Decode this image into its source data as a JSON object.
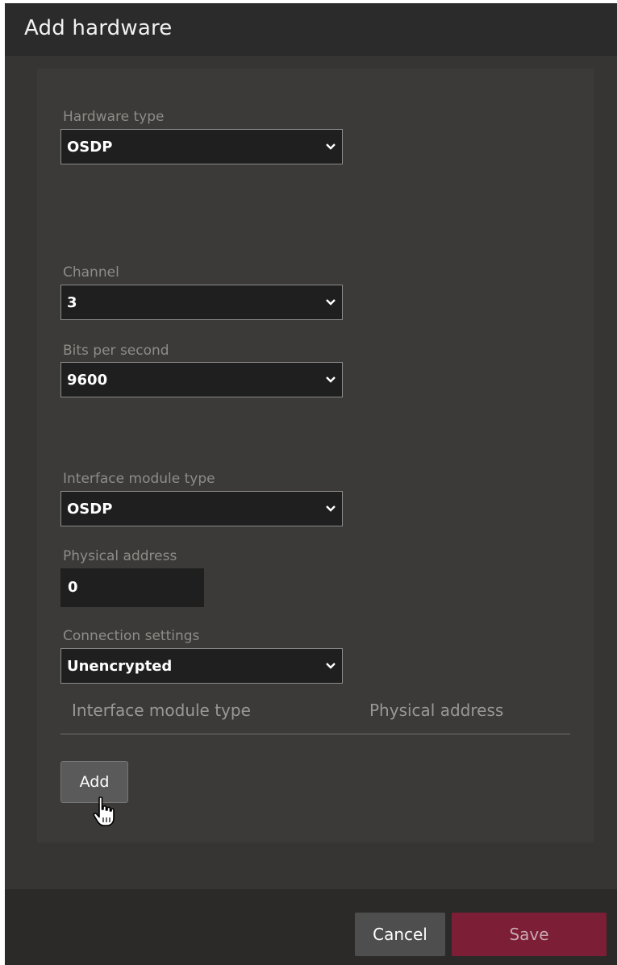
{
  "dialog": {
    "title": "Add hardware"
  },
  "form": {
    "hardware_type": {
      "label": "Hardware type",
      "value": "OSDP"
    },
    "channel": {
      "label": "Channel",
      "value": "3"
    },
    "bits_per_second": {
      "label": "Bits per second",
      "value": "9600"
    },
    "interface_module_type": {
      "label": "Interface module type",
      "value": "OSDP"
    },
    "physical_address": {
      "label": "Physical address",
      "value": "0"
    },
    "connection_settings": {
      "label": "Connection settings",
      "value": "Unencrypted"
    }
  },
  "table": {
    "columns": [
      "Interface module type",
      "Physical address"
    ]
  },
  "buttons": {
    "add": "Add",
    "cancel": "Cancel",
    "save": "Save"
  },
  "icons": {
    "dropdown": "chevron-down-icon",
    "cursor": "hand-pointer-icon"
  },
  "colors": {
    "save_accent": "#7c1e36"
  }
}
